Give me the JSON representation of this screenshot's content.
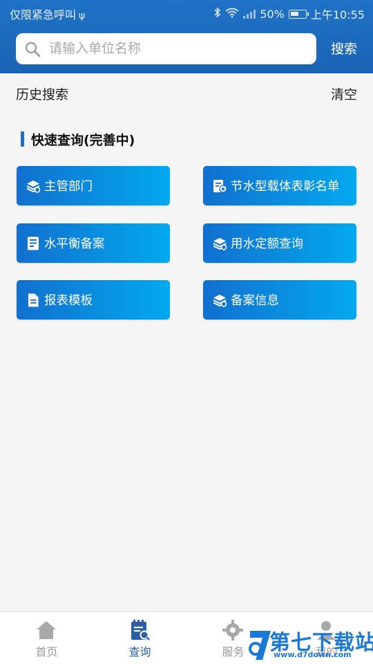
{
  "status_bar": {
    "left_text": "仅限紧急呼叫",
    "battery": "50%",
    "time": "上午10:55"
  },
  "search": {
    "placeholder": "请输入单位名称",
    "button": "搜索"
  },
  "history": {
    "title": "历史搜索",
    "clear": "清空"
  },
  "quick_query": {
    "title": "快速查询(完善中)",
    "buttons": [
      {
        "label": "主管部门",
        "icon": "layers-icon"
      },
      {
        "label": "节水型载体表彰名单",
        "icon": "certificate-icon"
      },
      {
        "label": "水平衡备案",
        "icon": "ledger-icon"
      },
      {
        "label": "用水定额查询",
        "icon": "layers-icon"
      },
      {
        "label": "报表模板",
        "icon": "document-icon"
      },
      {
        "label": "备案信息",
        "icon": "layers-icon"
      }
    ]
  },
  "bottom_nav": {
    "items": [
      {
        "label": "首页",
        "icon": "home-icon",
        "active": false
      },
      {
        "label": "查询",
        "icon": "query-icon",
        "active": true
      },
      {
        "label": "服务",
        "icon": "gear-icon",
        "active": false
      },
      {
        "label": "我的",
        "icon": "user-icon",
        "active": false
      }
    ]
  },
  "watermark": {
    "title": "第七下载站",
    "url": "www.d7down.com"
  },
  "colors": {
    "header": "#1f72c6",
    "button_gradient_start": "#1170cf",
    "button_gradient_end": "#03a9ef",
    "nav_active": "#2a5fa8"
  }
}
